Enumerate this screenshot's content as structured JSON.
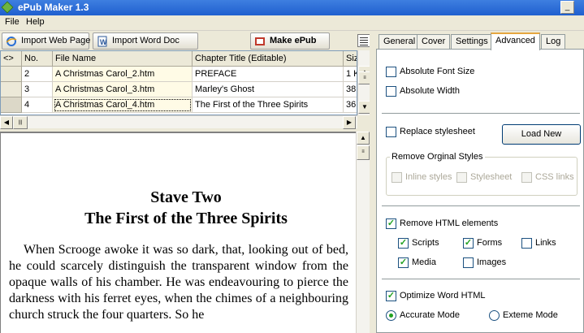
{
  "window": {
    "title": "ePub Maker 1.3",
    "minimize": "_",
    "close": "×"
  },
  "menu": [
    "File",
    "Help"
  ],
  "toolbar": {
    "import_web": "Import Web Page",
    "import_word": "Import Word Doc",
    "make_epub": "Make ePub"
  },
  "grid": {
    "headers": [
      "<>",
      "No.",
      "File Name",
      "Chapter Title (Editable)",
      "Size"
    ],
    "rows": [
      {
        "no": "2",
        "file": "A Christmas Carol_2.htm",
        "title": "PREFACE",
        "size": "1 K"
      },
      {
        "no": "3",
        "file": "A Christmas Carol_3.htm",
        "title": "Marley's Ghost",
        "size": "38"
      },
      {
        "no": "4",
        "file": "A Christmas Carol_4.htm",
        "title": "The First of the Three Spirits",
        "size": "36"
      }
    ]
  },
  "preview": {
    "heading": "Stave Two",
    "subheading": "The First of the Three Spirits",
    "body": "When Scrooge awoke it was so dark, that, looking out of bed, he could scarcely distinguish the transparent window from the opaque walls of his chamber. He was endeavouring to pierce the darkness with his ferret eyes, when the chimes of a neighbouring church struck the four quarters. So he"
  },
  "tabs": [
    "General",
    "Cover",
    "Settings",
    "Advanced",
    "Log"
  ],
  "active_tab": "Advanced",
  "advanced": {
    "absolute_font_size": {
      "label": "Absolute Font Size",
      "checked": false
    },
    "absolute_width": {
      "label": "Absolute Width",
      "checked": false
    },
    "replace_stylesheet": {
      "label": "Replace stylesheet",
      "checked": false
    },
    "load_new": "Load New",
    "remove_styles": {
      "legend": "Remove Orginal Styles",
      "inline": "Inline styles",
      "stylesheet": "Stylesheet",
      "css_links": "CSS links"
    },
    "remove_html": {
      "label": "Remove HTML elements",
      "checked": true
    },
    "scripts": {
      "label": "Scripts",
      "checked": true
    },
    "forms": {
      "label": "Forms",
      "checked": true
    },
    "links": {
      "label": "Links",
      "checked": false
    },
    "media": {
      "label": "Media",
      "checked": true
    },
    "images": {
      "label": "Images",
      "checked": false
    },
    "optimize_word": {
      "label": "Optimize Word HTML",
      "checked": true
    },
    "accurate_mode": {
      "label": "Accurate Mode",
      "selected": true
    },
    "extreme_mode": {
      "label": "Exteme Mode",
      "selected": false
    }
  },
  "colors": {
    "titlebar": "#1f5fcf",
    "active_tab_accent": "#e6a640",
    "check": "#21a121"
  }
}
